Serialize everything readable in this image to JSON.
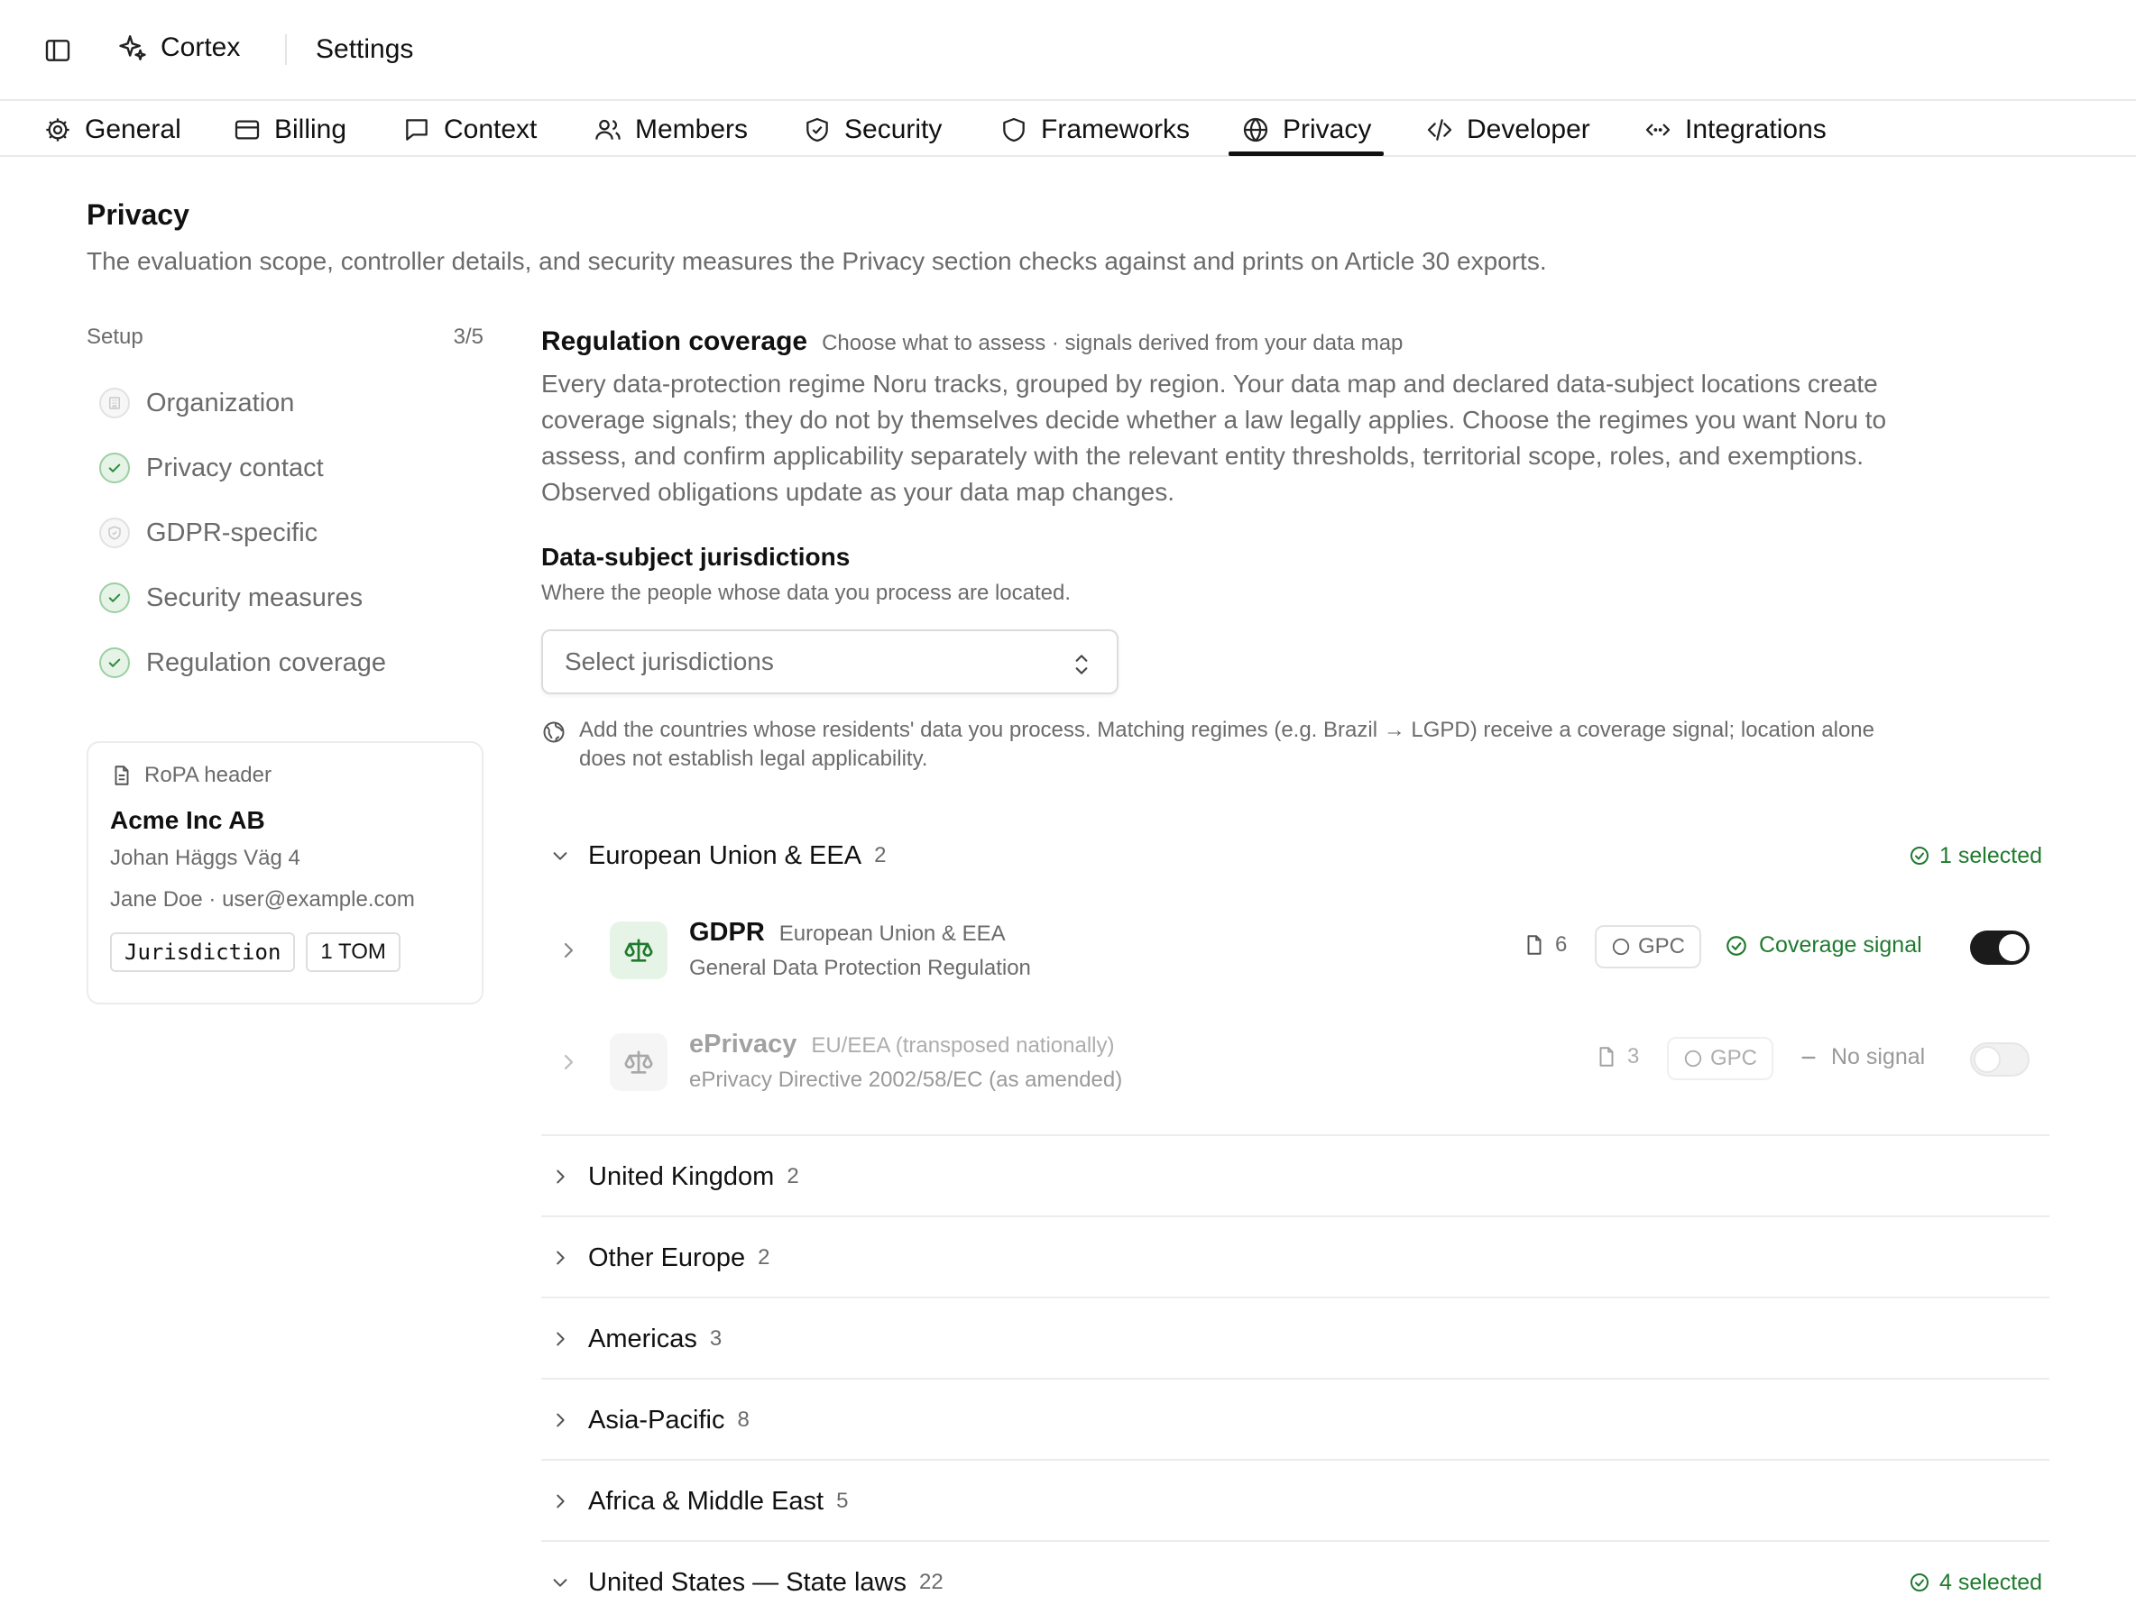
{
  "app": {
    "name": "Cortex",
    "breadcrumb": "Settings"
  },
  "tabs": [
    {
      "label": "General",
      "icon": "gear-icon"
    },
    {
      "label": "Billing",
      "icon": "card-icon"
    },
    {
      "label": "Context",
      "icon": "chat-icon"
    },
    {
      "label": "Members",
      "icon": "users-icon"
    },
    {
      "label": "Security",
      "icon": "shield-check-icon"
    },
    {
      "label": "Frameworks",
      "icon": "shield-icon"
    },
    {
      "label": "Privacy",
      "icon": "globe-lock-icon",
      "active": true
    },
    {
      "label": "Developer",
      "icon": "code-icon"
    },
    {
      "label": "Integrations",
      "icon": "arrows-icon"
    }
  ],
  "page": {
    "title": "Privacy",
    "description": "The evaluation scope, controller details, and security measures the Privacy section checks against and prints on Article 30 exports."
  },
  "setup": {
    "label": "Setup",
    "progress": "3/5",
    "steps": [
      {
        "label": "Organization",
        "done": false
      },
      {
        "label": "Privacy contact",
        "done": true
      },
      {
        "label": "GDPR-specific",
        "done": false
      },
      {
        "label": "Security measures",
        "done": true
      },
      {
        "label": "Regulation coverage",
        "done": true
      }
    ]
  },
  "ropa": {
    "header": "RoPA header",
    "name": "Acme Inc AB",
    "address": "Johan Häggs Väg 4",
    "contact": "Jane Doe · user@example.com",
    "chips": [
      "Jurisdiction",
      "1 TOM"
    ]
  },
  "coverage": {
    "title": "Regulation coverage",
    "subtitle": "Choose what to assess · signals derived from your data map",
    "description": "Every data-protection regime Noru tracks, grouped by region. Your data map and declared data-subject locations create coverage signals; they do not by themselves decide whether a law legally applies. Choose the regimes you want Noru to assess, and confirm applicability separately with the relevant entity thresholds, territorial scope, roles, and exemptions. Observed obligations update as your data map changes."
  },
  "jurisdictions": {
    "title": "Data-subject jurisdictions",
    "subtitle": "Where the people whose data you process are located.",
    "placeholder": "Select jurisdictions",
    "hint": "Add the countries whose residents' data you process. Matching regimes (e.g. Brazil → LGPD) receive a coverage signal; location alone does not establish legal applicability."
  },
  "groups": [
    {
      "name": "European Union & EEA",
      "count": "2",
      "expanded": true,
      "selected": "1 selected",
      "regulations": [
        {
          "name": "GDPR",
          "region": "European Union & EEA",
          "full": "General Data Protection Regulation",
          "docs": "6",
          "gpc": "GPC",
          "signal": "Coverage signal",
          "enabled": true
        },
        {
          "name": "ePrivacy",
          "region": "EU/EEA (transposed nationally)",
          "full": "ePrivacy Directive 2002/58/EC (as amended)",
          "docs": "3",
          "gpc": "GPC",
          "signal": "No signal",
          "enabled": false
        }
      ]
    },
    {
      "name": "United Kingdom",
      "count": "2",
      "expanded": false
    },
    {
      "name": "Other Europe",
      "count": "2",
      "expanded": false
    },
    {
      "name": "Americas",
      "count": "3",
      "expanded": false
    },
    {
      "name": "Asia-Pacific",
      "count": "8",
      "expanded": false
    },
    {
      "name": "Africa & Middle East",
      "count": "5",
      "expanded": false
    },
    {
      "name": "United States — State laws",
      "count": "22",
      "expanded": true,
      "selected": "4 selected"
    }
  ],
  "colors": {
    "accent_green": "#1f7a2e",
    "toggle_on": "#1b1b1b",
    "muted_text": "#6b6b6b"
  }
}
